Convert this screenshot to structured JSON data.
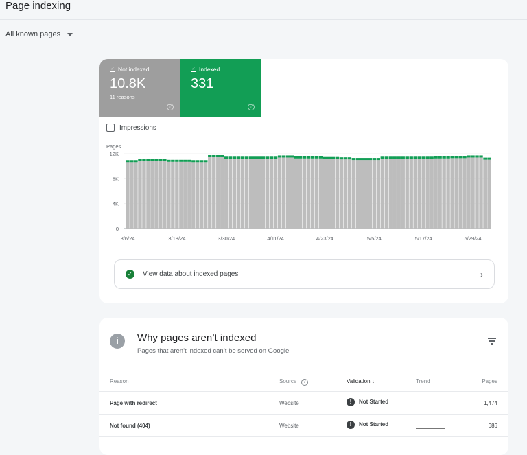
{
  "header": {
    "title": "Page indexing"
  },
  "filter": {
    "selected": "All known pages"
  },
  "summary": {
    "not_indexed": {
      "label": "Not indexed",
      "value": "10.8K",
      "sub": "11 reasons",
      "color": "#9e9e9e"
    },
    "indexed": {
      "label": "Indexed",
      "value": "331",
      "color": "#129e55"
    }
  },
  "impressions_label": "Impressions",
  "view_button": "View data about indexed pages",
  "chart_data": {
    "type": "bar",
    "stacked": true,
    "ylabel": "Pages",
    "ylim": [
      0,
      12000
    ],
    "yticks": [
      "0",
      "4K",
      "8K",
      "12K"
    ],
    "xticks": [
      "3/6/24",
      "3/18/24",
      "3/30/24",
      "4/11/24",
      "4/23/24",
      "5/5/24",
      "5/17/24",
      "5/29/24"
    ],
    "date_range": [
      "3/6/24",
      "6/2/24"
    ],
    "series": [
      {
        "name": "Not indexed",
        "color": "#bdbdbd",
        "values": [
          10650,
          10650,
          10650,
          10800,
          10800,
          10800,
          10800,
          10800,
          10800,
          10800,
          10700,
          10700,
          10700,
          10700,
          10700,
          10700,
          10650,
          10650,
          10650,
          10650,
          11450,
          11450,
          11450,
          11450,
          11200,
          11200,
          11200,
          11200,
          11200,
          11200,
          11200,
          11200,
          11200,
          11200,
          11200,
          11200,
          11200,
          11400,
          11400,
          11400,
          11400,
          11250,
          11250,
          11250,
          11250,
          11250,
          11250,
          11250,
          11150,
          11150,
          11150,
          11150,
          11100,
          11100,
          11100,
          11000,
          11000,
          11000,
          11000,
          11000,
          11000,
          11000,
          11200,
          11200,
          11200,
          11200,
          11200,
          11200,
          11200,
          11200,
          11200,
          11200,
          11200,
          11200,
          11200,
          11250,
          11250,
          11250,
          11250,
          11300,
          11300,
          11300,
          11300,
          11400,
          11400,
          11400,
          11400,
          11050,
          11050
        ]
      },
      {
        "name": "Indexed",
        "color": "#129e55",
        "values": [
          331
        ]
      }
    ],
    "grid": true
  },
  "why": {
    "title": "Why pages aren’t indexed",
    "subtitle": "Pages that aren’t indexed can’t be served on Google",
    "columns": [
      "Reason",
      "Source",
      "Validation",
      "Trend",
      "Pages"
    ],
    "rows": [
      {
        "reason": "Page with redirect",
        "source": "Website",
        "validation": "Not Started",
        "pages": "1,474"
      },
      {
        "reason": "Not found (404)",
        "source": "Website",
        "validation": "Not Started",
        "pages": "686"
      }
    ]
  }
}
